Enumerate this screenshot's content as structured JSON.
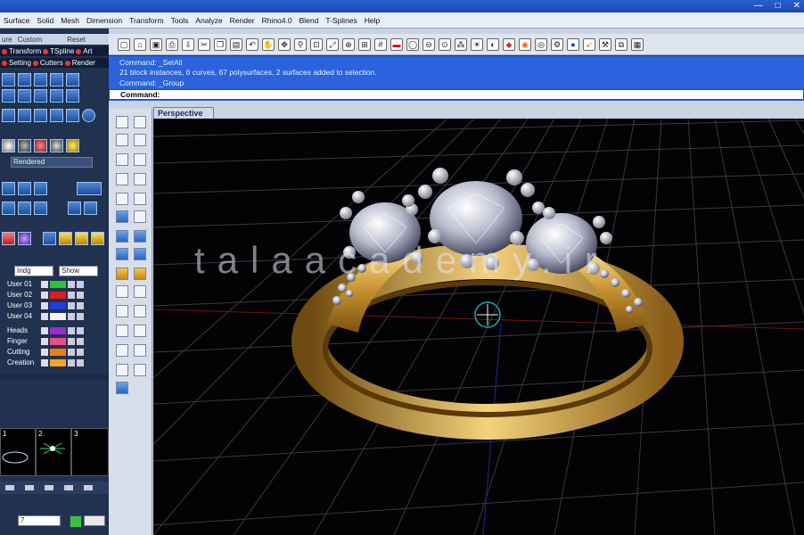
{
  "window": {
    "controls": [
      "—",
      "□",
      "✕"
    ]
  },
  "menu": [
    "Surface",
    "Solid",
    "Mesh",
    "Dimension",
    "Transform",
    "Tools",
    "Analyze",
    "Render",
    "Rhino4.0",
    "Blend",
    "T-Splines",
    "Help"
  ],
  "left_panel": {
    "tabs": [
      "ure",
      "Custom",
      "Reset"
    ],
    "row1": [
      "Transform",
      "TSpline",
      "Art"
    ],
    "row2": [
      "Setting",
      "Cutters",
      "Render"
    ],
    "material_select": "Rendered",
    "layers_header": [
      "Indg",
      "Show"
    ],
    "layers": [
      {
        "name": "User 01",
        "color": "#2ec43a"
      },
      {
        "name": "User 02",
        "color": "#e21b1b"
      },
      {
        "name": "User 03",
        "color": "#1d3fe0"
      },
      {
        "name": "User 04",
        "color": "#f5f5f5"
      },
      {
        "name": "Heads",
        "color": "#9c2ad1"
      },
      {
        "name": "Finger",
        "color": "#e84d8a"
      },
      {
        "name": "Cutting",
        "color": "#f27b12"
      },
      {
        "name": "Creation",
        "color": "#f5a623"
      }
    ],
    "thumbnails": [
      "1",
      "2",
      "3"
    ],
    "bottom_select": "7"
  },
  "command": {
    "lines": [
      "Command: _SelAll",
      "21 block instances, 6 curves, 67 polysurfaces, 2 surfaces added to selection.",
      "Command: _Group"
    ],
    "prompt": "Command:"
  },
  "viewport": {
    "label": "Perspective",
    "watermark": "talaacademy.ir"
  },
  "toolbar_icons": [
    "new-icon",
    "open-icon",
    "save-icon",
    "print-icon",
    "import-icon",
    "cut-icon",
    "copy-icon",
    "paste-icon",
    "undo-icon",
    "pan-icon",
    "rotate-view-icon",
    "zoom-icon",
    "zoom-window-icon",
    "zoom-extents-icon",
    "zoom-selected-icon",
    "four-view-icon",
    "grid-icon",
    "car-icon",
    "ring-icon",
    "snap-icon",
    "osnap-icon",
    "point-icon",
    "light-icon",
    "shade-icon",
    "render-icon",
    "material-icon",
    "sphere-icon",
    "options-icon",
    "gumball-icon",
    "help-icon"
  ]
}
